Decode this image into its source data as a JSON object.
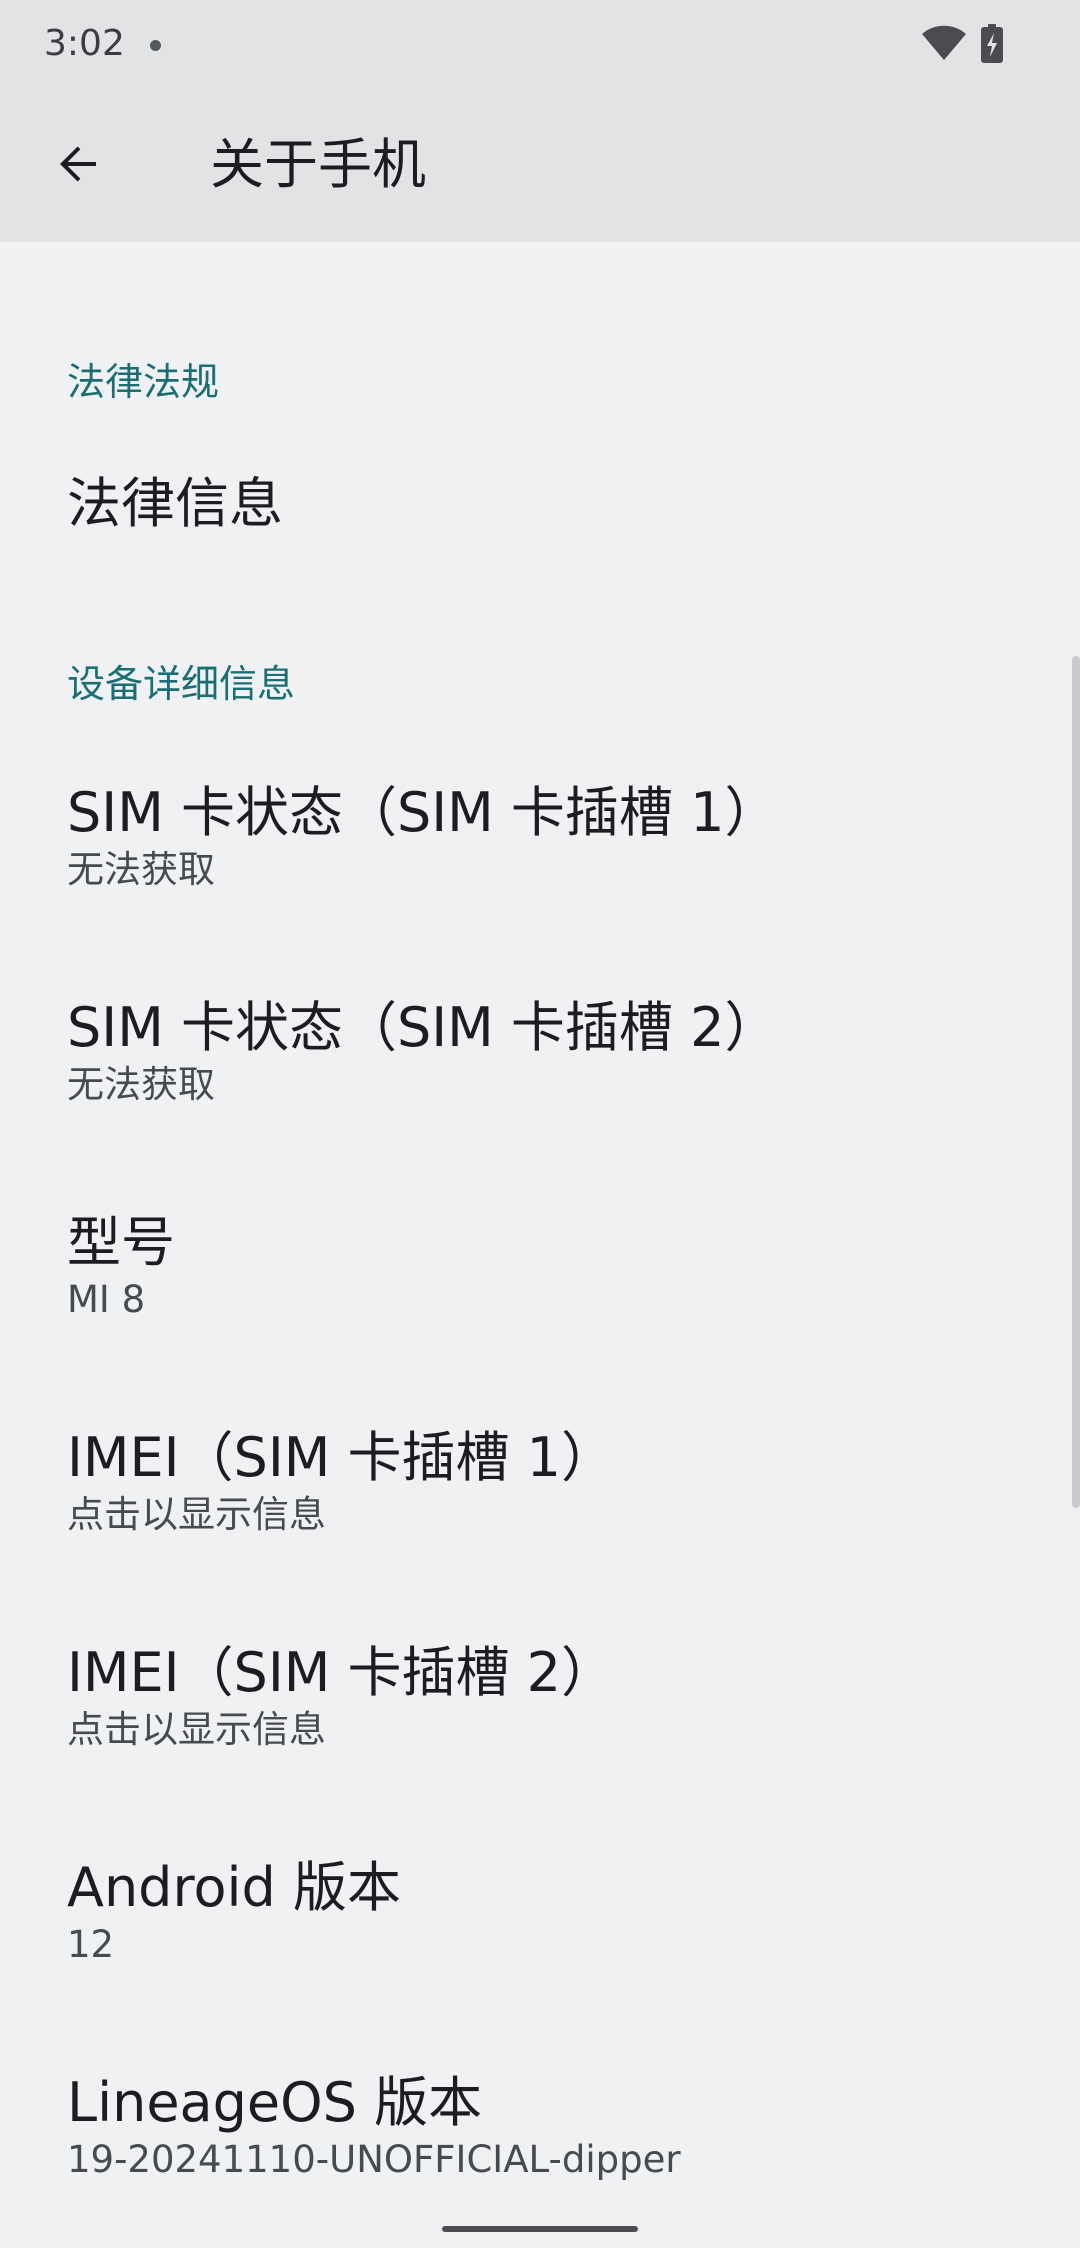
{
  "status_bar": {
    "time": "3:02"
  },
  "app_bar": {
    "title": "关于手机",
    "back_icon": "arrow-back-icon"
  },
  "sections": {
    "legal": {
      "header": "法律法规",
      "items": [
        {
          "title": "法律信息"
        }
      ]
    },
    "device": {
      "header": "设备详细信息",
      "items": [
        {
          "title": "SIM 卡状态（SIM 卡插槽 1）",
          "summary": "无法获取"
        },
        {
          "title": "SIM 卡状态（SIM 卡插槽 2）",
          "summary": "无法获取"
        },
        {
          "title": "型号",
          "summary": "MI 8"
        },
        {
          "title": "IMEI（SIM 卡插槽 1）",
          "summary": "点击以显示信息"
        },
        {
          "title": "IMEI（SIM 卡插槽 2）",
          "summary": "点击以显示信息"
        },
        {
          "title": "Android 版本",
          "summary": "12"
        },
        {
          "title": "LineageOS 版本",
          "summary": "19-20241110-UNOFFICIAL-dipper"
        }
      ]
    }
  },
  "colors": {
    "accent": "#1b6f74",
    "background": "#f0f1f3",
    "top_band": "#e2e3e5"
  }
}
